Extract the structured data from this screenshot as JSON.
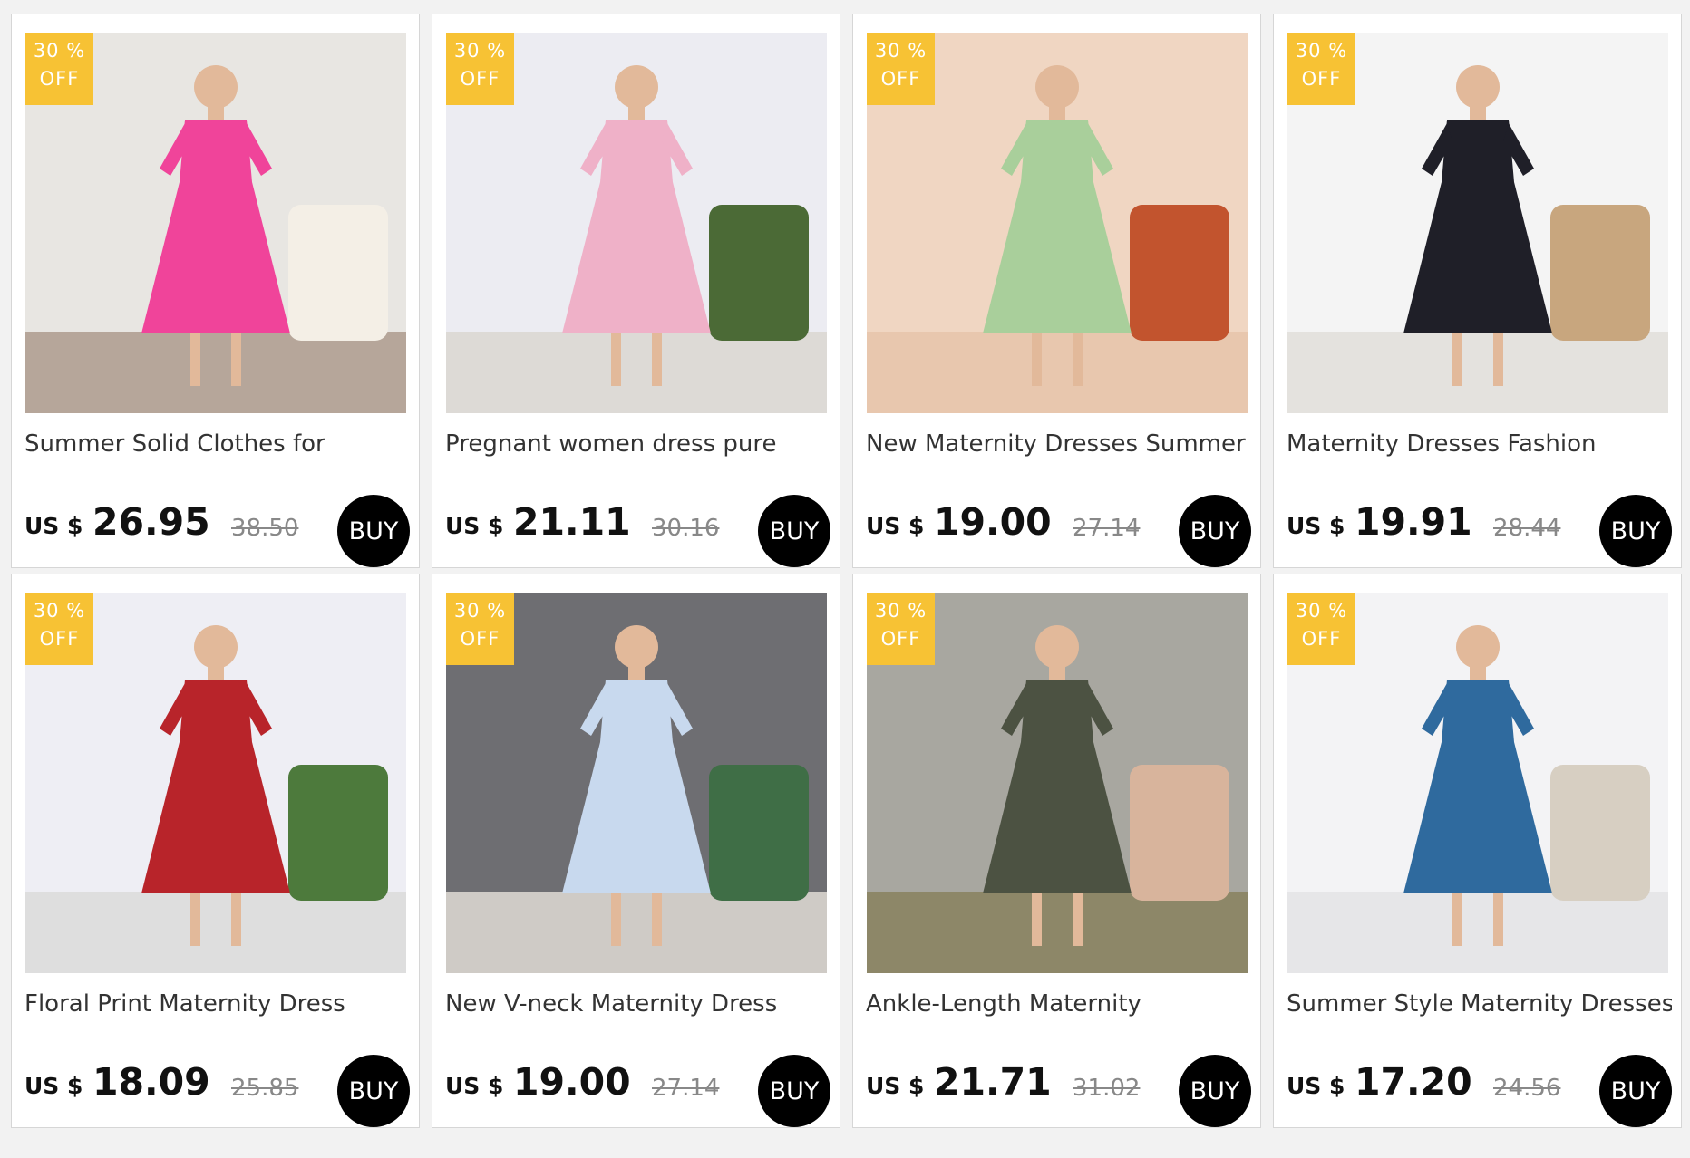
{
  "products": [
    {
      "discount_pct": "30 %",
      "discount_off": "OFF",
      "title": "Summer Solid Clothes for",
      "currency": "US $",
      "price": "26.95",
      "original_price": "38.50",
      "buy_label": "BUY",
      "image_colors": {
        "bg": "#e8e6e2",
        "floor": "#b6a69a",
        "dress": "#f0449a",
        "accent": "#f4efe6"
      }
    },
    {
      "discount_pct": "30 %",
      "discount_off": "OFF",
      "title": "Pregnant women dress pure",
      "currency": "US $",
      "price": "21.11",
      "original_price": "30.16",
      "buy_label": "BUY",
      "image_colors": {
        "bg": "#ececf2",
        "floor": "#dddad6",
        "dress": "#efb1c8",
        "accent": "#4b6a36"
      }
    },
    {
      "discount_pct": "30 %",
      "discount_off": "OFF",
      "title": "New Maternity Dresses Summer",
      "currency": "US $",
      "price": "19.00",
      "original_price": "27.14",
      "buy_label": "BUY",
      "image_colors": {
        "bg": "#f0d6c2",
        "floor": "#e8c7ae",
        "dress": "#a9cf9b",
        "accent": "#c2542e"
      }
    },
    {
      "discount_pct": "30 %",
      "discount_off": "OFF",
      "title": "Maternity Dresses Fashion",
      "currency": "US $",
      "price": "19.91",
      "original_price": "28.44",
      "buy_label": "BUY",
      "image_colors": {
        "bg": "#f4f4f4",
        "floor": "#e4e2de",
        "dress": "#1f1f28",
        "accent": "#c8a67e"
      }
    },
    {
      "discount_pct": "30 %",
      "discount_off": "OFF",
      "title": "Floral Print Maternity Dress",
      "currency": "US $",
      "price": "18.09",
      "original_price": "25.85",
      "buy_label": "BUY",
      "image_colors": {
        "bg": "#eeeef4",
        "floor": "#dedede",
        "dress": "#b8242a",
        "accent": "#4d7a3c"
      }
    },
    {
      "discount_pct": "30 %",
      "discount_off": "OFF",
      "title": "New V-neck Maternity Dress",
      "currency": "US $",
      "price": "19.00",
      "original_price": "27.14",
      "buy_label": "BUY",
      "image_colors": {
        "bg": "#6e6e72",
        "floor": "#cfcbc6",
        "dress": "#c8d9ee",
        "accent": "#3f6e46"
      }
    },
    {
      "discount_pct": "30 %",
      "discount_off": "OFF",
      "title": "Ankle-Length Maternity",
      "currency": "US $",
      "price": "21.71",
      "original_price": "31.02",
      "buy_label": "BUY",
      "image_colors": {
        "bg": "#a8a7a0",
        "floor": "#8d8768",
        "dress": "#4c5242",
        "accent": "#d8b49c"
      }
    },
    {
      "discount_pct": "30 %",
      "discount_off": "OFF",
      "title": "Summer Style Maternity Dresses",
      "currency": "US $",
      "price": "17.20",
      "original_price": "24.56",
      "buy_label": "BUY",
      "image_colors": {
        "bg": "#f3f3f5",
        "floor": "#e6e6e8",
        "dress": "#2f6a9e",
        "accent": "#d7cfc2"
      }
    }
  ]
}
